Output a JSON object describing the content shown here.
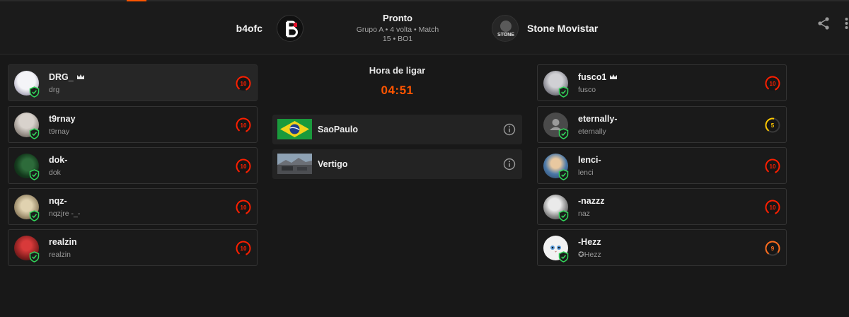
{
  "match": {
    "team1": {
      "name": "b4ofc"
    },
    "team2": {
      "name": "Stone Movistar",
      "logo_text": "STONE"
    },
    "status": "Pronto",
    "subtitle_line1": "Grupo A • 4 volta • Match",
    "subtitle_line2": "15 • BO1"
  },
  "center": {
    "title": "Hora de ligar",
    "countdown": "04:51",
    "server": {
      "label": "SaoPaulo"
    },
    "map": {
      "label": "Vertigo"
    }
  },
  "team1_players": [
    {
      "name": "DRG_",
      "nick": "drg",
      "level": "10",
      "captain": true
    },
    {
      "name": "t9rnay",
      "nick": "t9rnay",
      "level": "10"
    },
    {
      "name": "dok-",
      "nick": "dok",
      "level": "10"
    },
    {
      "name": "nqz-",
      "nick": "nqzjre -_-",
      "level": "10"
    },
    {
      "name": "realzin",
      "nick": "realzin",
      "level": "10"
    }
  ],
  "team2_players": [
    {
      "name": "fusco1",
      "nick": "fusco",
      "level": "10",
      "captain": true
    },
    {
      "name": "eternally-",
      "nick": "eternally",
      "level": "5"
    },
    {
      "name": "lenci-",
      "nick": "lenci",
      "level": "10"
    },
    {
      "name": "-nazzz",
      "nick": "naz",
      "level": "10"
    },
    {
      "name": "-Hezz",
      "nick": "✪Hezz",
      "level": "9"
    }
  ],
  "colors": {
    "accent": "#ff5500",
    "level10": "#fe1f00",
    "level9": "#fd6c1e",
    "level5": "#ffc800",
    "verified": "#32d35a"
  },
  "icons": [
    "share-icon",
    "more-vert-icon",
    "crown-icon",
    "shield-check-icon",
    "info-icon"
  ]
}
